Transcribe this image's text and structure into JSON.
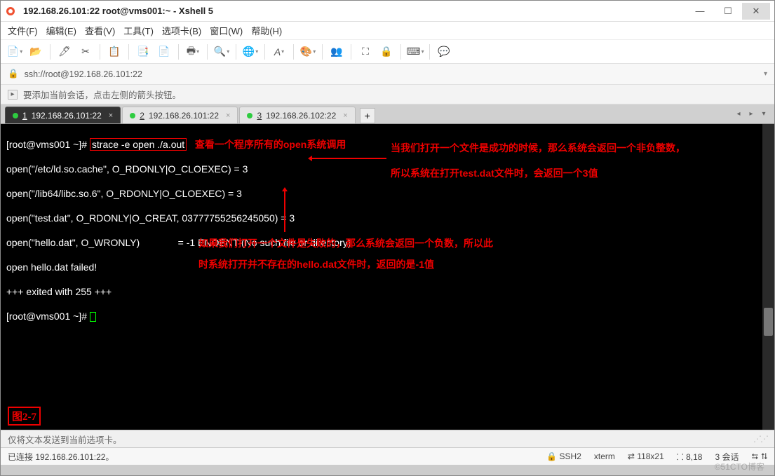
{
  "window": {
    "title": "192.168.26.101:22   root@vms001:~ - Xshell 5"
  },
  "menu": {
    "file": "文件(F)",
    "edit": "编辑(E)",
    "view": "查看(V)",
    "tools": "工具(T)",
    "tab": "选项卡(B)",
    "window": "窗口(W)",
    "help": "帮助(H)"
  },
  "address": {
    "scheme_icon": "🔒",
    "url": "ssh://root@192.168.26.101:22"
  },
  "hint": {
    "text": "要添加当前会话，点击左侧的箭头按钮。"
  },
  "tabs": {
    "items": [
      {
        "index": "1",
        "label": "192.168.26.101:22"
      },
      {
        "index": "2",
        "label": "192.168.26.101:22"
      },
      {
        "index": "3",
        "label": "192.168.26.102:22"
      }
    ]
  },
  "terminal": {
    "prompt1_pre": "[root@vms001 ~]# ",
    "cmd": "strace -e open ./a.out",
    "lines": [
      "open(\"/etc/ld.so.cache\", O_RDONLY|O_CLOEXEC) = 3",
      "open(\"/lib64/libc.so.6\", O_RDONLY|O_CLOEXEC) = 3",
      "open(\"test.dat\", O_RDONLY|O_CREAT, 03777755256245050) = 3",
      "open(\"hello.dat\", O_WRONLY)              = -1 ENOENT (No such file or directory)",
      "open hello.dat failed!",
      "+++ exited with 255 +++"
    ],
    "prompt2": "[root@vms001 ~]# "
  },
  "annotations": {
    "cmd_note": "查看一个程序所有的open系统调用",
    "note_ok_1": "当我们打开一个文件是成功的时候，那么系统会返回一个非负整数，",
    "note_ok_2": "所以系统在打开test.dat文件时，会返回一个3值",
    "note_fail_1": "如果我们打开一个文件是失败的，那么系统会返回一个负数，所以此",
    "note_fail_2": "时系统打开并不存在的hello.dat文件时，返回的是-1值",
    "figure": "图2-7"
  },
  "statusmid": {
    "text": "仅将文本发送到当前选项卡。"
  },
  "status": {
    "conn": "已连接 192.168.26.101:22。",
    "proto": "SSH2",
    "term": "xterm",
    "size": "118x21",
    "pos": "8,18",
    "sessions": "3 会话",
    "encoding_icons": "⮀ ⮁"
  },
  "watermark": "©51CTO博客"
}
